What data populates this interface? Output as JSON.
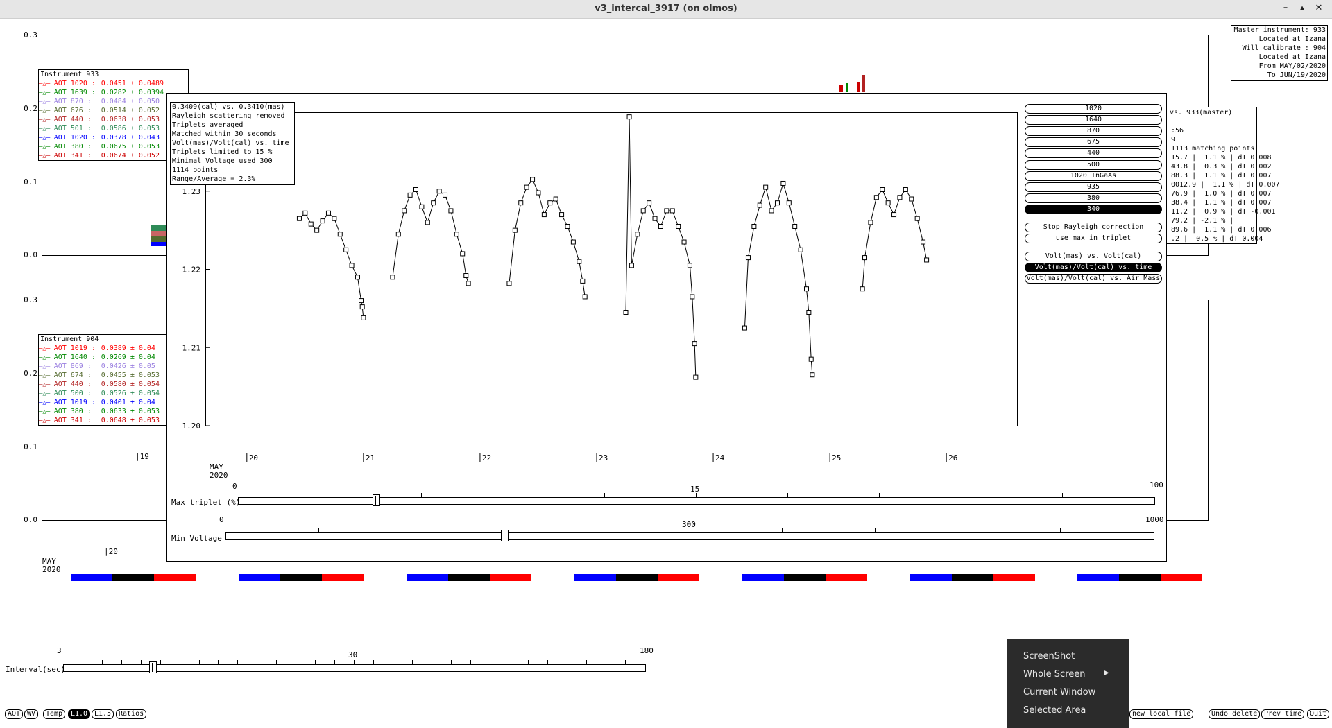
{
  "window": {
    "title": "v3_intercal_3917 (on olmos)"
  },
  "info": {
    "master_instrument": "Master instrument: 933",
    "master_location": "Located at Izana",
    "will_calibrate": "Will calibrate   : 904",
    "cal_location": "Located at Izana",
    "from": "From MAY/02/2020",
    "to": "To JUN/19/2020"
  },
  "back_top": {
    "yticks": [
      "0.3",
      "0.2",
      "0.1",
      "0.0"
    ],
    "legend_title": "Instrument 933",
    "legend": [
      {
        "label": "AOT 1020 :",
        "value": "0.0451 ± 0.0489",
        "color": "#ff0000"
      },
      {
        "label": "AOT 1639 :",
        "value": "0.0282 ± 0.0394",
        "color": "#008800"
      },
      {
        "label": "AOT 870 :",
        "value": "0.0484 ± 0.050",
        "color": "#9a7fe0"
      },
      {
        "label": "AOT 676 :",
        "value": "0.0514 ± 0.052",
        "color": "#556b2f"
      },
      {
        "label": "AOT 440 :",
        "value": "0.0638 ± 0.053",
        "color": "#b22222"
      },
      {
        "label": "AOT 501 :",
        "value": "0.0586 ± 0.053",
        "color": "#2e8b57"
      },
      {
        "label": "AOT 1020 :",
        "value": "0.0378 ± 0.043",
        "color": "#0000ff"
      },
      {
        "label": "AOT 380 :",
        "value": "0.0675 ± 0.053",
        "color": "#008800"
      },
      {
        "label": "AOT 341 :",
        "value": "0.0674 ± 0.052",
        "color": "#cc0000"
      }
    ]
  },
  "back_bottom": {
    "yticks": [
      "0.3",
      "0.2",
      "0.1",
      "0.0"
    ],
    "legend_title": "Instrument 904",
    "legend": [
      {
        "label": "AOT 1019 :",
        "value": "0.0389 ± 0.04",
        "color": "#ff0000"
      },
      {
        "label": "AOT 1640 :",
        "value": "0.0269 ± 0.04",
        "color": "#008800"
      },
      {
        "label": "AOT 869 :",
        "value": "0.0426 ± 0.05",
        "color": "#9a7fe0"
      },
      {
        "label": "AOT 674 :",
        "value": "0.0455 ± 0.053",
        "color": "#556b2f"
      },
      {
        "label": "AOT 440 :",
        "value": "0.0580 ± 0.054",
        "color": "#b22222"
      },
      {
        "label": "AOT 500 :",
        "value": "0.0526 ± 0.054",
        "color": "#2e8b57"
      },
      {
        "label": "AOT 1019 :",
        "value": "0.0401 ± 0.04",
        "color": "#0000ff"
      },
      {
        "label": "AOT 380 :",
        "value": "0.0633 ± 0.053",
        "color": "#008800"
      },
      {
        "label": "AOT 341 :",
        "value": "0.0648 ± 0.053",
        "color": "#cc0000"
      }
    ],
    "xtick_19": "|19",
    "xtick_20": "|20",
    "month": "MAY",
    "year": "2020"
  },
  "right_panel": {
    "lines": [
      "vs. 933(master)",
      "",
      ":56",
      "9",
      "1113 matching points",
      "15.7 |  1.1 % | dT 0.008",
      "43.8 |  0.3 % | dT 0.002",
      "88.3 |  1.1 % | dT 0.007",
      "0012.9 |  1.1 % | dT 0.007",
      "76.9 |  1.0 % | dT 0.007",
      "38.4 |  1.1 % | dT 0.007",
      "11.2 |  0.9 % | dT -0.001",
      "79.2 | -2.1 % |",
      "89.6 |  1.1 % | dT 0.006",
      ".2 |  0.5 % | dT 0.004"
    ]
  },
  "dialog": {
    "info_lines": [
      "0.3409(cal) vs. 0.3410(mas)",
      "Rayleigh scattering removed",
      "Triplets averaged",
      "Matched within 30 seconds",
      "Volt(mas)/Volt(cal) vs. time",
      "Triplets limited to 15 %",
      "Minimal Voltage used 300",
      "1114 points",
      "Range/Average = 2.3%"
    ],
    "wavelength_buttons": [
      "1020",
      "1640",
      "870",
      "675",
      "440",
      "500",
      "1020 InGaAs",
      "935",
      "380",
      "340"
    ],
    "selected_wavelength": "340",
    "option_buttons": [
      "Stop Rayleigh correction",
      "use max in triplet"
    ],
    "plot_buttons": [
      "Volt(mas) vs. Volt(cal)",
      "Volt(mas)/Volt(cal) vs. time",
      "Volt(mas)/Volt(cal) vs. Air Mass"
    ],
    "selected_plot": "Volt(mas)/Volt(cal) vs. time",
    "month": "MAY",
    "year": "2020",
    "max_triplet": {
      "label": "Max triplet (%)",
      "min": "0",
      "max": "100",
      "value": "15",
      "fraction": 0.15
    },
    "min_voltage": {
      "label": "Min Voltage",
      "min": "0",
      "max": "1000",
      "value": "300",
      "fraction": 0.3
    }
  },
  "chart_data": {
    "type": "scatter",
    "title": "",
    "xlabel": "",
    "ylabel": "",
    "x_ticks": [
      "20",
      "21",
      "22",
      "23",
      "24",
      "25",
      "26"
    ],
    "y_ticks": [
      "1.20",
      "1.21",
      "1.22",
      "1.23"
    ],
    "xlim": [
      19.65,
      26.6
    ],
    "ylim": [
      1.2,
      1.24
    ],
    "marker": "open-square",
    "segments": [
      {
        "day": 20,
        "x": [
          20.45,
          20.5,
          20.55,
          20.6,
          20.65,
          20.7,
          20.75,
          20.8,
          20.85,
          20.9,
          20.95,
          20.98,
          20.99,
          21.0
        ],
        "y": [
          1.2265,
          1.2272,
          1.2258,
          1.225,
          1.2262,
          1.2272,
          1.2265,
          1.2245,
          1.2225,
          1.2205,
          1.219,
          1.216,
          1.2152,
          1.2138
        ]
      },
      {
        "day": 21,
        "x": [
          21.25,
          21.3,
          21.35,
          21.4,
          21.45,
          21.5,
          21.55,
          21.6,
          21.65,
          21.7,
          21.75,
          21.8,
          21.85,
          21.88,
          21.9
        ],
        "y": [
          1.219,
          1.2245,
          1.2275,
          1.2295,
          1.2302,
          1.228,
          1.226,
          1.2285,
          1.23,
          1.2295,
          1.2275,
          1.2245,
          1.222,
          1.2192,
          1.2182
        ]
      },
      {
        "day": 22,
        "x": [
          22.25,
          22.3,
          22.35,
          22.4,
          22.45,
          22.5,
          22.55,
          22.6,
          22.65,
          22.7,
          22.75,
          22.8,
          22.85,
          22.88,
          22.9
        ],
        "y": [
          1.2182,
          1.225,
          1.2285,
          1.2305,
          1.2315,
          1.2298,
          1.227,
          1.2285,
          1.229,
          1.227,
          1.2255,
          1.2235,
          1.221,
          1.2185,
          1.2165
        ]
      },
      {
        "day": 23,
        "x": [
          23.25,
          23.28,
          23.3,
          23.35,
          23.4,
          23.45,
          23.5,
          23.55,
          23.6,
          23.65,
          23.7,
          23.75,
          23.8,
          23.82,
          23.84,
          23.85
        ],
        "y": [
          1.2145,
          1.2395,
          1.2205,
          1.2245,
          1.2275,
          1.2285,
          1.2265,
          1.2255,
          1.2275,
          1.2275,
          1.2255,
          1.2235,
          1.2205,
          1.2165,
          1.2105,
          1.2062
        ]
      },
      {
        "day": 24,
        "x": [
          24.27,
          24.3,
          24.35,
          24.4,
          24.45,
          24.5,
          24.55,
          24.6,
          24.65,
          24.7,
          24.75,
          24.8,
          24.82,
          24.84,
          24.85
        ],
        "y": [
          1.2125,
          1.2215,
          1.2255,
          1.2282,
          1.2305,
          1.2275,
          1.2285,
          1.231,
          1.2285,
          1.2255,
          1.2225,
          1.2175,
          1.2145,
          1.2085,
          1.2065
        ]
      },
      {
        "day": 25,
        "x": [
          25.28,
          25.3,
          25.35,
          25.4,
          25.45,
          25.5,
          25.55,
          25.6,
          25.65,
          25.7,
          25.75,
          25.8,
          25.83
        ],
        "y": [
          1.2175,
          1.2215,
          1.226,
          1.2292,
          1.2302,
          1.2285,
          1.227,
          1.2292,
          1.2302,
          1.229,
          1.2265,
          1.2235,
          1.2212
        ]
      }
    ]
  },
  "interval": {
    "label": "Interval(sec)",
    "min": "3",
    "max": "180",
    "value": "30",
    "fraction": 0.153
  },
  "bottom_buttons": [
    "AOT",
    "WV",
    "Temp",
    "L1.0",
    "L1.5",
    "Ratios"
  ],
  "selected_bottom": "L1.0",
  "right_buttons": [
    "new local file",
    "Undo delete",
    "Prev time",
    "Quit"
  ],
  "context_menu": {
    "items": [
      "ScreenShot",
      "Whole Screen",
      "Current Window",
      "Selected Area"
    ]
  },
  "colors": {
    "blue": "#0000ff",
    "black": "#000000",
    "red": "#ff0000",
    "menu_bg": "#2b2b2b"
  }
}
